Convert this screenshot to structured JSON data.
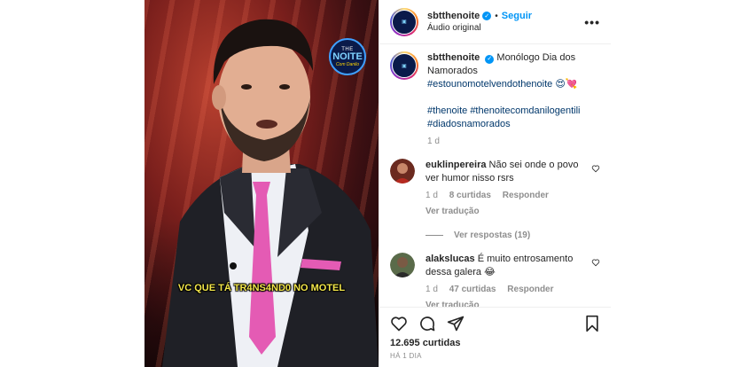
{
  "video": {
    "logo_line1": "THE",
    "logo_line2": "NOITE",
    "logo_line3": "Com Danilo",
    "subtitle": "VC QUE TÁ TR4NS4ND0 NO MOTEL"
  },
  "post": {
    "username": "sbtthenoite",
    "follow_label": "Seguir",
    "audio_label": "Áudio original",
    "more_label": "•••"
  },
  "caption": {
    "username": "sbtthenoite",
    "text": "Monólogo Dia dos Namorados",
    "hashtag_line": "#estounomotelvendothenoite 😍💘",
    "hashtags2": "#thenoite #thenoitecomdanilogentili #diadosnamorados",
    "time": "1 d"
  },
  "comments": [
    {
      "username": "euklinpereira",
      "text": "Não sei onde o povo ver humor nisso rsrs",
      "time": "1 d",
      "likes": "8 curtidas",
      "reply": "Responder",
      "translate": "Ver tradução",
      "avatar_color": "#8a3b2a"
    },
    {
      "username": "alakslucas",
      "text": "É muito entrosamento dessa galera 😂",
      "time": "1 d",
      "likes": "47 curtidas",
      "reply": "Responder",
      "translate": "Ver tradução",
      "avatar_color": "#4a5a3a"
    }
  ],
  "view_replies": "Ver respostas (19)",
  "footer": {
    "likes": "12.695 curtidas",
    "date": "HÁ 1 DIA"
  },
  "colors": {
    "accent": "#0095f6",
    "subtitle": "#f2e64a",
    "muted": "#8e8e8e"
  }
}
